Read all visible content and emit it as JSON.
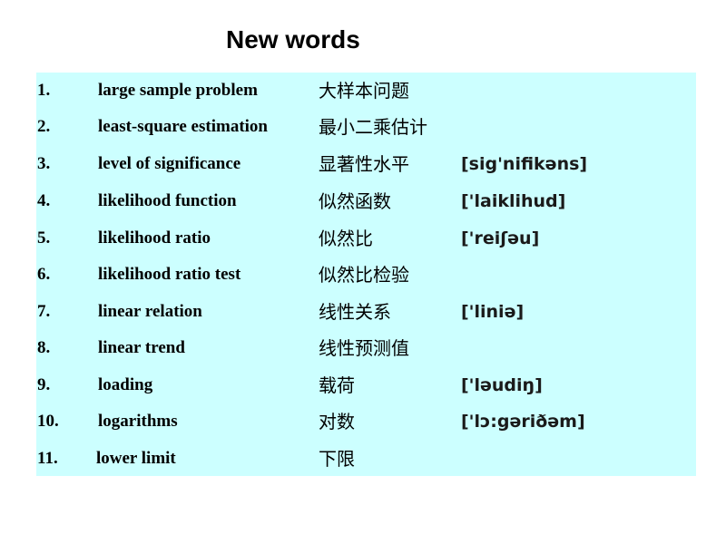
{
  "title": "New words",
  "colors": {
    "box_background": "#ccffff",
    "text": "#000000"
  },
  "words": [
    {
      "number": "1.",
      "term": "large sample problem",
      "chinese": "大样本问题",
      "phonetic": ""
    },
    {
      "number": "2.",
      "term": "least-square estimation",
      "chinese": "最小二乘估计",
      "phonetic": ""
    },
    {
      "number": "3.",
      "term": "level of significance",
      "chinese": "显著性水平",
      "phonetic": "[sig'nifikəns]"
    },
    {
      "number": "4.",
      "term": "likelihood function",
      "chinese": "似然函数",
      "phonetic": "['laiklihud]"
    },
    {
      "number": "5.",
      "term": "likelihood ratio",
      "chinese": "似然比",
      "phonetic": "['reiʃəu]"
    },
    {
      "number": "6.",
      "term": "likelihood ratio test",
      "chinese": "似然比检验",
      "phonetic": ""
    },
    {
      "number": "7.",
      "term": "linear relation",
      "chinese": "线性关系",
      "phonetic": "['liniə]"
    },
    {
      "number": "8.",
      "term": "linear trend",
      "chinese": "线性预测值",
      "phonetic": ""
    },
    {
      "number": "9.",
      "term": "loading",
      "chinese": "载荷",
      "phonetic": "['ləudiŋ]"
    },
    {
      "number": "10.",
      "term": "logarithms",
      "chinese": "对数",
      "phonetic": "['lɔ:gəriðəm]"
    },
    {
      "number": "11.",
      "term": "lower limit",
      "chinese": "下限",
      "phonetic": ""
    }
  ]
}
